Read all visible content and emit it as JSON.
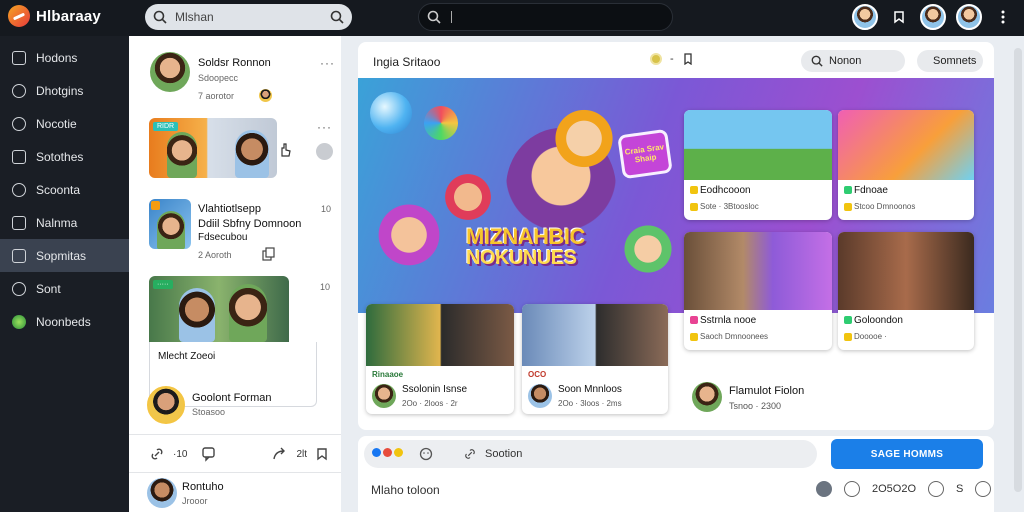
{
  "app": {
    "name": "Hlbaraay"
  },
  "topbar": {
    "search_value": "Mlshan"
  },
  "nav": [
    {
      "label": "Hodons",
      "icon": "image-icon"
    },
    {
      "label": "Dhotgins",
      "icon": "play-icon"
    },
    {
      "label": "Nocotie",
      "icon": "compass-icon"
    },
    {
      "label": "Sotothes",
      "icon": "share-icon"
    },
    {
      "label": "Scoonta",
      "icon": "camera-icon"
    },
    {
      "label": "Nalnma",
      "icon": "monitor-icon"
    },
    {
      "label": "Sopmitas",
      "icon": "gallery-icon"
    },
    {
      "label": "Sont",
      "icon": "wand-icon"
    },
    {
      "label": "Noonbeds",
      "icon": "globe-icon"
    }
  ],
  "feed": {
    "post1": {
      "name": "Soldsr Ronnon",
      "meta1": "Sdoopecc",
      "meta2": "7 aorotor"
    },
    "post2": {
      "thumb_label": "RIDR"
    },
    "post3": {
      "line1": "Vlahtiotlsepp",
      "line2": "Ddiil Sbfny Domnoon",
      "line3": "Fdsecubou",
      "meta": "2 Aoroth",
      "count": "10"
    },
    "post4": {
      "caption": "Mlecht Zoeoi",
      "count": "10"
    },
    "post5": {
      "name": "Goolont Forman",
      "meta": "Stoasoo"
    },
    "actions": {
      "count1": "·10",
      "count2": "2lt"
    },
    "post6": {
      "name": "Rontuho",
      "meta": "Jrooor"
    }
  },
  "main": {
    "title": "Ingia Sritaoo",
    "btn1": "Nonon",
    "btn2": "Somnets",
    "banner": {
      "title_line1": "MIZNAHBIC",
      "title_line2": "NOKUNUES",
      "sign": "Craia Srav Shaip"
    },
    "cards": [
      {
        "title": "Eodhcooon",
        "meta": "Sote · 3Btoosloc"
      },
      {
        "title": "Fdnoae",
        "meta": "Stcoo Dmnoonos"
      },
      {
        "title": "Sstrnla nooe",
        "meta": "Saoch Dmnoonees"
      },
      {
        "title": "Goloondon",
        "meta": "Dooooe ·"
      },
      {
        "title": "Ssolonin Isnse",
        "meta": "2Oo · 2loos · 2r"
      },
      {
        "title": "Soon Mnnloos",
        "meta": "2Oo · 3loos · 2ms"
      },
      {
        "title": "Flamulot Fiolon",
        "meta": "Tsnoo · 2300"
      }
    ],
    "card1_tag": "Rinaaoe",
    "card2_tag": "OCO"
  },
  "composer": {
    "placeholder": "Sootion",
    "primary": "SAGE HOMMS",
    "label": "Mlaho toloon",
    "tool_text": "2O5O2O"
  }
}
